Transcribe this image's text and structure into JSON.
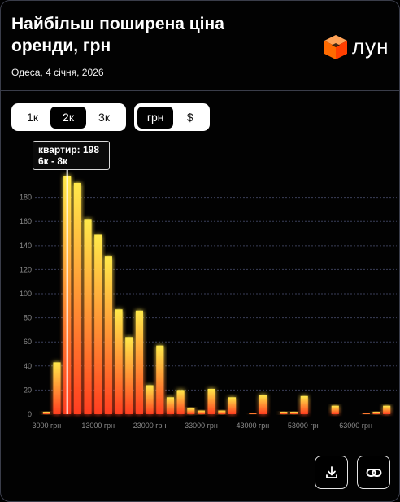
{
  "header": {
    "title": "Найбільш поширена ціна оренди, грн",
    "subtitle": "Одеса, 4 січня, 2026",
    "logo_text": "лун",
    "logo_color": "#ff6a00"
  },
  "toggles": {
    "bin_size": {
      "options": [
        "1к",
        "2к",
        "3к"
      ],
      "selected": "2к"
    },
    "currency": {
      "options": [
        "грн",
        "$"
      ],
      "selected": "грн"
    }
  },
  "tooltip": {
    "line1": "квартир: 198",
    "line2": "6к - 8к"
  },
  "buttons": {
    "download_icon": "download-icon",
    "link_icon": "link-icon"
  },
  "chart_data": {
    "type": "bar",
    "x_unit": "грн",
    "bin_width": 2000,
    "bin_starts": [
      2000,
      4000,
      6000,
      8000,
      10000,
      12000,
      14000,
      16000,
      18000,
      20000,
      22000,
      24000,
      26000,
      28000,
      30000,
      32000,
      34000,
      36000,
      38000,
      40000,
      42000,
      44000,
      46000,
      48000,
      50000,
      52000,
      54000,
      56000,
      58000,
      60000,
      62000,
      64000,
      66000,
      68000
    ],
    "values": [
      2,
      43,
      198,
      192,
      162,
      149,
      131,
      87,
      64,
      86,
      24,
      57,
      14,
      20,
      5,
      3,
      21,
      3,
      14,
      0,
      1,
      16,
      0,
      2,
      2,
      15,
      0,
      0,
      7,
      0,
      0,
      1,
      2,
      7
    ],
    "highlighted_bin": 2,
    "xlim": [
      2000,
      70000
    ],
    "ylim": [
      0,
      198
    ],
    "x_ticks": [
      3000,
      13000,
      23000,
      33000,
      43000,
      53000,
      63000
    ],
    "x_tick_labels": [
      "3000 грн",
      "13000 грн",
      "23000 грн",
      "33000 грн",
      "43000 грн",
      "53000 грн",
      "63000 грн"
    ],
    "y_ticks": [
      0,
      20,
      40,
      60,
      80,
      100,
      120,
      140,
      160,
      180
    ],
    "grid": true,
    "colors": {
      "bar_top": "#ffe94a",
      "bar_bottom": "#ff3d1f",
      "grid": "#3b3f5a",
      "axis_text": "#8c8c8c"
    }
  }
}
